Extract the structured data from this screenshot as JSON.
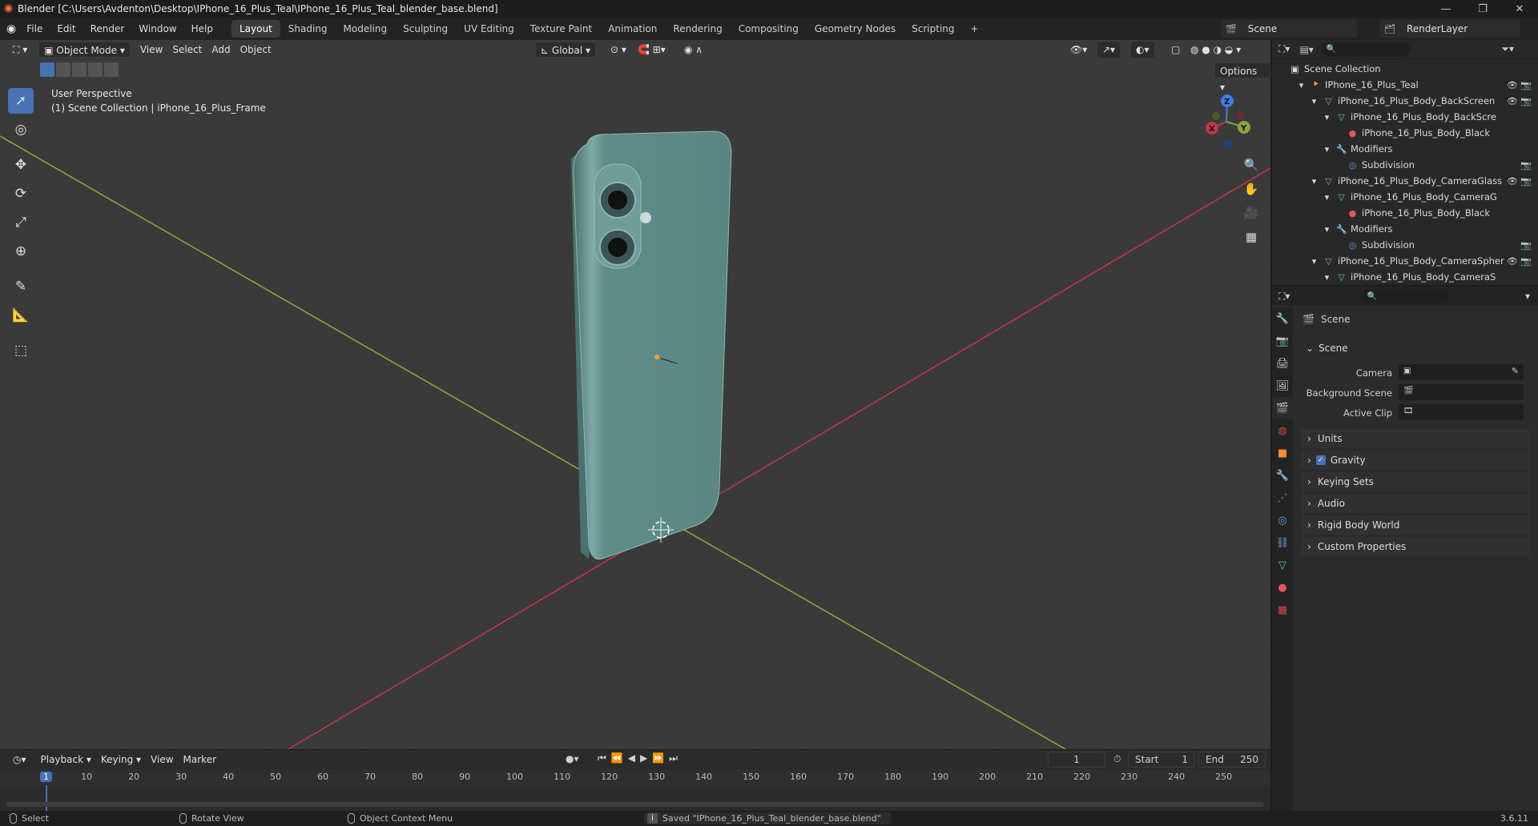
{
  "window": {
    "title": "Blender [C:\\Users\\Avdenton\\Desktop\\IPhone_16_Plus_Teal\\IPhone_16_Plus_Teal_blender_base.blend]",
    "minimize": "—",
    "maximize": "❐",
    "close": "✕"
  },
  "menu": {
    "file": "File",
    "edit": "Edit",
    "render": "Render",
    "window": "Window",
    "help": "Help"
  },
  "workspaces": [
    "Layout",
    "Shading",
    "Modeling",
    "Sculpting",
    "UV Editing",
    "Texture Paint",
    "Animation",
    "Rendering",
    "Compositing",
    "Geometry Nodes",
    "Scripting"
  ],
  "workspace_add": "+",
  "scene_selector": {
    "value": "Scene"
  },
  "view_layer": {
    "value": "RenderLayer"
  },
  "viewport_header": {
    "mode": "Object Mode",
    "view": "View",
    "select": "Select",
    "add": "Add",
    "object": "Object",
    "transform_orientation": "Global",
    "options": "Options"
  },
  "viewport_info": {
    "perspective": "User Perspective",
    "context": "(1) Scene Collection | iPhone_16_Plus_Frame"
  },
  "gizmo": {
    "x": "X",
    "y": "Y",
    "z": "Z"
  },
  "outliner": {
    "root": "Scene Collection",
    "rows": [
      {
        "label": "IPhone_16_Plus_Teal",
        "icon": "collection-icon",
        "vis": "👁  📷"
      },
      {
        "label": "iPhone_16_Plus_Body_BackScreen",
        "icon": "mesh-object-icon",
        "vis": "👁  📷"
      },
      {
        "label": "iPhone_16_Plus_Body_BackScre",
        "icon": "mesh-data-icon",
        "vis": ""
      },
      {
        "label": "iPhone_16_Plus_Body_Black",
        "icon": "material-icon",
        "vis": ""
      },
      {
        "label": "Modifiers",
        "icon": "wrench-icon",
        "vis": ""
      },
      {
        "label": "Subdivision",
        "icon": "modifier-icon",
        "vis": "📷"
      },
      {
        "label": "iPhone_16_Plus_Body_CameraGlass",
        "icon": "mesh-object-icon",
        "vis": "👁  📷"
      },
      {
        "label": "iPhone_16_Plus_Body_CameraG",
        "icon": "mesh-data-icon",
        "vis": ""
      },
      {
        "label": "iPhone_16_Plus_Body_Black",
        "icon": "material-icon",
        "vis": ""
      },
      {
        "label": "Modifiers",
        "icon": "wrench-icon",
        "vis": ""
      },
      {
        "label": "Subdivision",
        "icon": "modifier-icon",
        "vis": "📷"
      },
      {
        "label": "iPhone_16_Plus_Body_CameraSpher",
        "icon": "mesh-object-icon",
        "vis": "👁  📷"
      },
      {
        "label": "iPhone_16_Plus_Body_CameraS",
        "icon": "mesh-data-icon",
        "vis": ""
      }
    ]
  },
  "properties": {
    "context": "Scene",
    "panel_scene": "Scene",
    "camera_label": "Camera",
    "background_scene_label": "Background Scene",
    "active_clip_label": "Active Clip",
    "panels": [
      "Units",
      "Gravity",
      "Keying Sets",
      "Audio",
      "Rigid Body World",
      "Custom Properties"
    ],
    "gravity_checked": true
  },
  "timeline": {
    "playback": "Playback",
    "keying": "Keying",
    "view": "View",
    "marker": "Marker",
    "current_frame": "1",
    "start_label": "Start",
    "start": "1",
    "end_label": "End",
    "end": "250",
    "ruler": [
      "1",
      "10",
      "20",
      "30",
      "40",
      "50",
      "60",
      "70",
      "80",
      "90",
      "100",
      "110",
      "120",
      "130",
      "140",
      "150",
      "160",
      "170",
      "180",
      "190",
      "200",
      "210",
      "220",
      "230",
      "240",
      "250"
    ]
  },
  "status": {
    "select": "Select",
    "rotate": "Rotate View",
    "context_menu": "Object Context Menu",
    "message": "Saved \"IPhone_16_Plus_Teal_blender_base.blend\"",
    "version": "3.6.11"
  },
  "colors": {
    "accent": "#4772b3",
    "x_axis": "#c1364d",
    "y_axis": "#88a63a",
    "z_axis": "#3f7ee0",
    "phone": "#5f8c88"
  }
}
